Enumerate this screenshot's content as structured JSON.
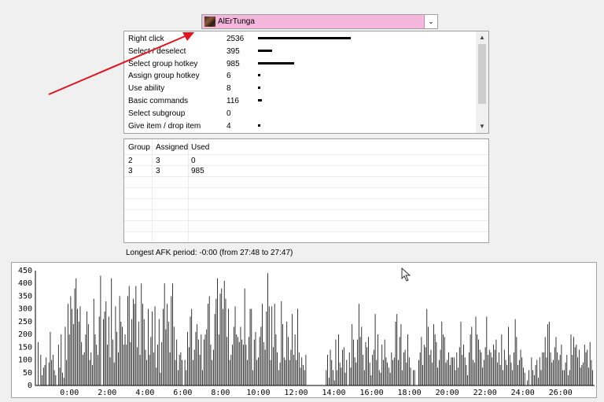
{
  "player": {
    "name": "AlErTunga",
    "arrow": "⌄"
  },
  "actions": {
    "items": [
      {
        "name": "Right click",
        "count": "2536"
      },
      {
        "name": "Select / deselect",
        "count": "395"
      },
      {
        "name": "Select group hotkey",
        "count": "985"
      },
      {
        "name": "Assign group hotkey",
        "count": "6"
      },
      {
        "name": "Use ability",
        "count": "8"
      },
      {
        "name": "Basic commands",
        "count": "116"
      },
      {
        "name": "Select subgroup",
        "count": "0"
      },
      {
        "name": "Give item / drop item",
        "count": "4"
      }
    ],
    "max_count": 2536,
    "scroll_up": "▲",
    "scroll_down": "▼"
  },
  "groups": {
    "headers": [
      "Group",
      "Assigned",
      "Used"
    ],
    "rows": [
      [
        "2",
        "3",
        "0"
      ],
      [
        "3",
        "3",
        "985"
      ]
    ]
  },
  "afk": {
    "text": "Longest AFK period: -0:00 (from 27:48 to 27:47)"
  },
  "chart_data": {
    "type": "bar",
    "title": "",
    "xlabel": "",
    "ylabel": "",
    "ylim": [
      0,
      450
    ],
    "yticks": [
      "450",
      "400",
      "350",
      "300",
      "250",
      "200",
      "150",
      "100",
      "50",
      "0"
    ],
    "xticks": [
      "0:00",
      "2:00",
      "4:00",
      "6:00",
      "8:00",
      "10:00",
      "12:00",
      "14:00",
      "16:00",
      "18:00",
      "20:00",
      "22:00",
      "24:00",
      "26:00"
    ],
    "x_range_minutes": [
      -1.8,
      27.8
    ],
    "bar_color": "#000000",
    "values": [
      170,
      0,
      120,
      40,
      70,
      80,
      110,
      0,
      90,
      210,
      100,
      120,
      60,
      40,
      0,
      160,
      70,
      200,
      50,
      30,
      230,
      100,
      320,
      200,
      350,
      300,
      240,
      380,
      420,
      300,
      250,
      310,
      170,
      120,
      130,
      200,
      290,
      240,
      100,
      130,
      80,
      340,
      200,
      160,
      120,
      270,
      430,
      0,
      260,
      290,
      330,
      160,
      270,
      110,
      420,
      180,
      90,
      310,
      210,
      130,
      350,
      250,
      230,
      160,
      200,
      160,
      350,
      390,
      170,
      260,
      340,
      320,
      390,
      150,
      250,
      120,
      400,
      320,
      260,
      140,
      100,
      300,
      120,
      190,
      290,
      130,
      310,
      70,
      160,
      260,
      50,
      170,
      300,
      400,
      220,
      320,
      250,
      130,
      350,
      400,
      230,
      100,
      180,
      60,
      120,
      130,
      100,
      0,
      100,
      60,
      210,
      150,
      270,
      300,
      100,
      140,
      210,
      240,
      180,
      120,
      200,
      60,
      180,
      200,
      220,
      320,
      350,
      160,
      100,
      140,
      280,
      340,
      420,
      200,
      360,
      380,
      300,
      410,
      340,
      190,
      300,
      100,
      120,
      160,
      230,
      310,
      200,
      190,
      170,
      230,
      180,
      160,
      380,
      160,
      100,
      190,
      300,
      300,
      60,
      180,
      210,
      100,
      110,
      190,
      230,
      320,
      170,
      140,
      290,
      440,
      310,
      100,
      310,
      150,
      320,
      200,
      130,
      60,
      90,
      330,
      240,
      110,
      100,
      250,
      190,
      100,
      140,
      280,
      120,
      200,
      100,
      300,
      130,
      70,
      110,
      80,
      60,
      120,
      0,
      0,
      0,
      0,
      0,
      0,
      0,
      0,
      0,
      0,
      0,
      0,
      0,
      0,
      60,
      120,
      30,
      140,
      100,
      60,
      20,
      180,
      60,
      200,
      90,
      70,
      140,
      150,
      50,
      100,
      0,
      130,
      70,
      240,
      180,
      110,
      90,
      180,
      320,
      190,
      230,
      120,
      60,
      170,
      150,
      190,
      90,
      40,
      120,
      140,
      280,
      100,
      200,
      60,
      50,
      160,
      100,
      180,
      110,
      90,
      70,
      50,
      130,
      100,
      110,
      250,
      280,
      100,
      190,
      240,
      60,
      130,
      140,
      90,
      200,
      110,
      70,
      0,
      60,
      60,
      0,
      0,
      100,
      130,
      190,
      80,
      160,
      150,
      300,
      230,
      120,
      140,
      90,
      240,
      200,
      170,
      70,
      100,
      140,
      250,
      200,
      190,
      90,
      100,
      130,
      80,
      110,
      110,
      110,
      60,
      130,
      70,
      150,
      250,
      120,
      160,
      110,
      80,
      40,
      130,
      200,
      230,
      100,
      90,
      270,
      200,
      180,
      140,
      130,
      70,
      100,
      150,
      270,
      120,
      140,
      130,
      110,
      160,
      140,
      180,
      90,
      130,
      80,
      200,
      60,
      140,
      100,
      80,
      230,
      120,
      90,
      60,
      130,
      260,
      190,
      80,
      100,
      140,
      110,
      70,
      50,
      0,
      20,
      60,
      0,
      110,
      60,
      40,
      80,
      100,
      30,
      110,
      60,
      130,
      130,
      190,
      110,
      240,
      250,
      130,
      90,
      100,
      150,
      190,
      130,
      100,
      120,
      160,
      60,
      60,
      90,
      120,
      40,
      60,
      200,
      120,
      190,
      150,
      160,
      110,
      140,
      70,
      80,
      90,
      160,
      130,
      140,
      70,
      170,
      100,
      60
    ]
  }
}
